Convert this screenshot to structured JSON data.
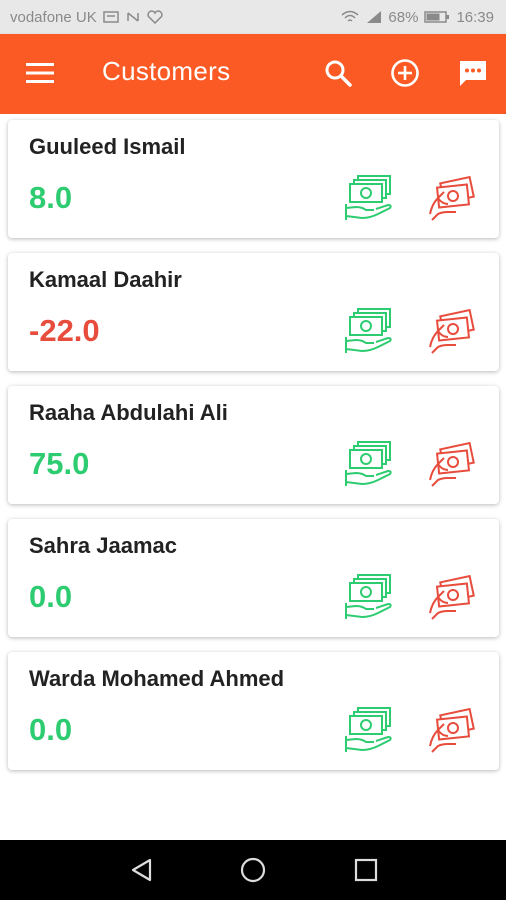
{
  "status_bar": {
    "carrier": "vodafone UK",
    "battery": "68%",
    "time": "16:39"
  },
  "app_bar": {
    "title": "Customers",
    "icons": [
      "menu-icon",
      "search-icon",
      "add-circle-icon",
      "message-icon"
    ]
  },
  "customers": [
    {
      "name": "Guuleed Ismail",
      "balance": "8.0"
    },
    {
      "name": "Kamaal Daahir",
      "balance": "-22.0"
    },
    {
      "name": "Raaha Abdulahi Ali",
      "balance": "75.0"
    },
    {
      "name": "Sahra Jaamac",
      "balance": "0.0"
    },
    {
      "name": "Warda Mohamed Ahmed",
      "balance": "0.0"
    }
  ],
  "colors": {
    "accent": "#fb5a24",
    "positive": "#2ecc71",
    "negative": "#e74c3c"
  },
  "nav_bar": {
    "icons": [
      "back-icon",
      "home-icon",
      "recents-icon"
    ]
  }
}
